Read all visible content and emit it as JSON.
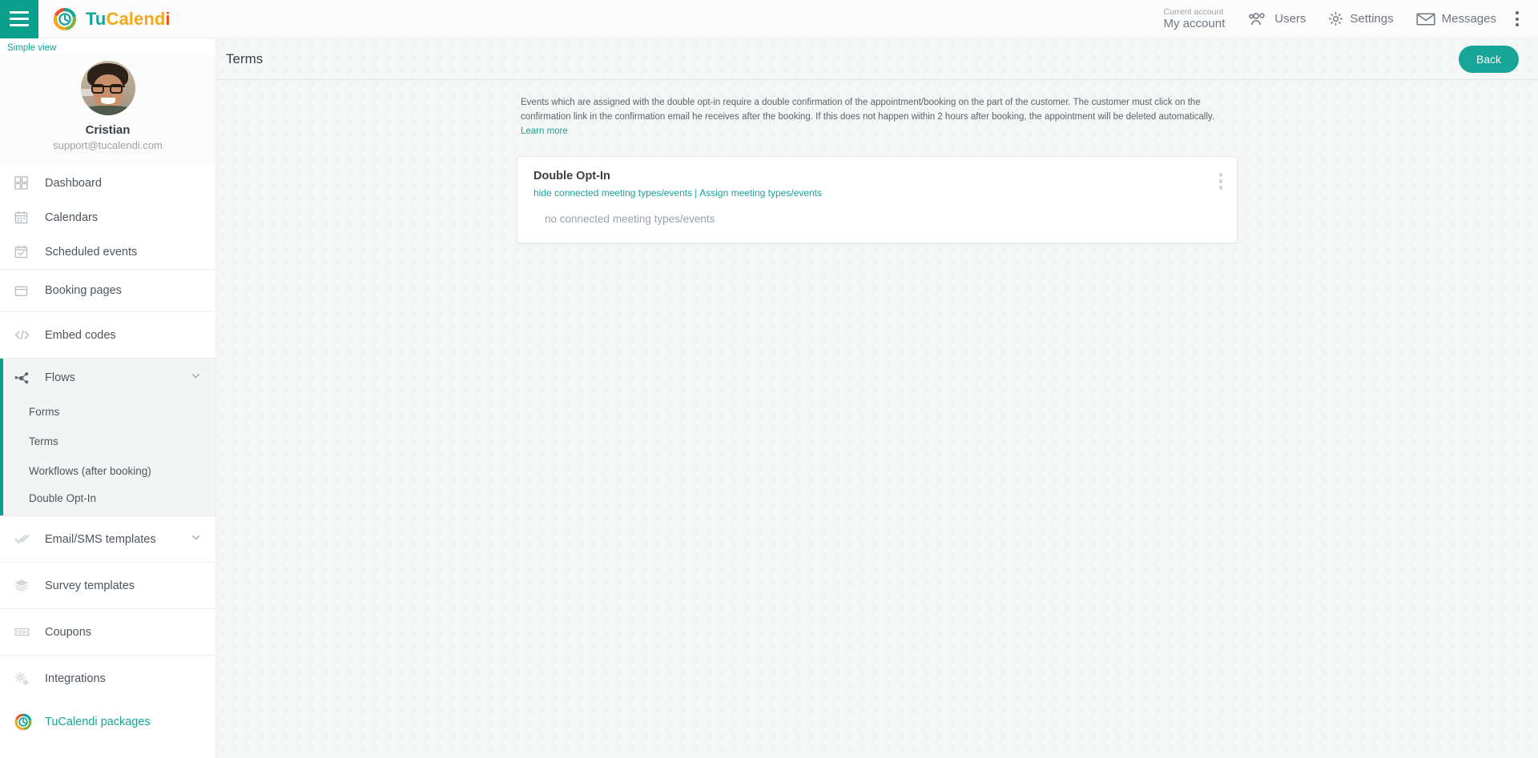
{
  "header": {
    "menu_icon": "hamburger-icon",
    "brand": {
      "part1": "Tu",
      "part2": "Calend",
      "part3": "i"
    },
    "account": {
      "caption": "Current account",
      "value": "My account"
    },
    "items": [
      {
        "label": "Users",
        "icon": "users-icon"
      },
      {
        "label": "Settings",
        "icon": "gear-icon"
      },
      {
        "label": "Messages",
        "icon": "envelope-icon"
      }
    ],
    "overflow_icon": "kebab-menu-icon"
  },
  "sidebar": {
    "simple_view": "Simple view",
    "profile": {
      "name": "Cristian",
      "email": "support@tucalendi.com",
      "avatar": "user-avatar"
    },
    "items": [
      {
        "label": "Dashboard",
        "icon": "dashboard-grid-icon"
      },
      {
        "label": "Calendars",
        "icon": "calendar-icon"
      },
      {
        "label": "Scheduled events",
        "icon": "calendar-check-icon"
      },
      {
        "label": "Booking pages",
        "icon": "window-icon"
      },
      {
        "label": "Embed codes",
        "icon": "code-brackets-icon"
      },
      {
        "label": "Flows",
        "icon": "flow-nodes-icon"
      },
      {
        "label": "Email/SMS templates",
        "icon": "double-check-icon"
      },
      {
        "label": "Survey templates",
        "icon": "layers-icon"
      },
      {
        "label": "Coupons",
        "icon": "ticket-icon"
      },
      {
        "label": "Integrations",
        "icon": "gears-icon"
      },
      {
        "label": "TuCalendi packages",
        "icon": "tucalendi-logo-icon"
      }
    ],
    "flows_submenu": [
      {
        "label": "Forms"
      },
      {
        "label": "Terms"
      },
      {
        "label": "Workflows (after booking)"
      },
      {
        "label": "Double Opt-In"
      }
    ]
  },
  "main": {
    "title": "Terms",
    "back_label": "Back",
    "intro_text": "Events which are assigned with the double opt-in require a double confirmation of the appointment/booking on the part of the customer. The customer must click on the confirmation link in the confirmation email he receives after the booking. If this does not happen within 2 hours after booking, the appointment will be deleted automatically.",
    "intro_link": "Learn more",
    "card": {
      "title": "Double Opt-In",
      "link_hide": "hide connected meeting types/events",
      "separator": "|",
      "link_assign": "Assign meeting types/events",
      "empty_text": "no connected meeting types/events",
      "menu_icon": "kebab-menu-icon"
    }
  },
  "colors": {
    "accent": "#17a398",
    "teal_dark": "#0b9f8d",
    "button": "#16a596"
  }
}
